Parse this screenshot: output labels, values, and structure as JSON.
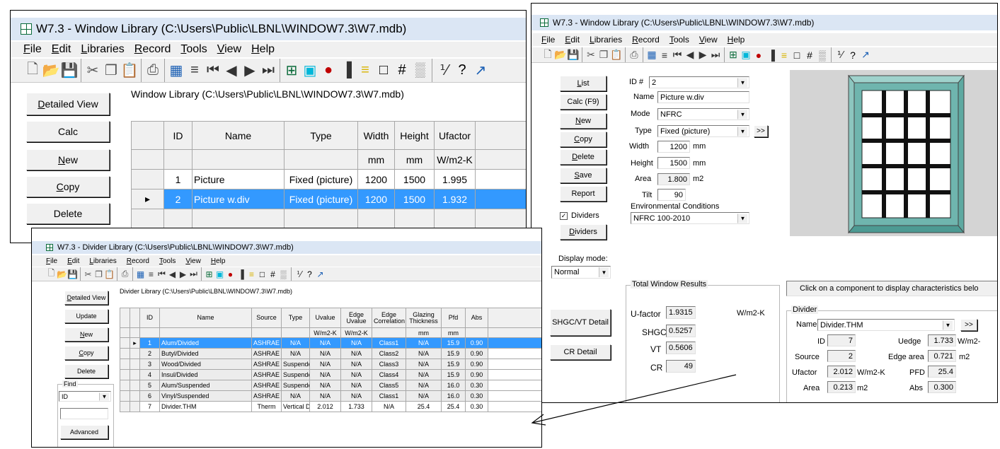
{
  "library_window": {
    "title": "W7.3 - Window Library (C:\\Users\\Public\\LBNL\\WINDOW7.3\\W7.mdb)",
    "menu": [
      "File",
      "Edit",
      "Libraries",
      "Record",
      "Tools",
      "View",
      "Help"
    ],
    "path_label": "Window Library (C:\\Users\\Public\\LBNL\\WINDOW7.3\\W7.mdb)",
    "buttons": {
      "detailed_view": "Detailed View",
      "calc": "Calc",
      "new": "New",
      "copy": "Copy",
      "delete": "Delete"
    },
    "table": {
      "headers": [
        "ID",
        "Name",
        "Type",
        "Width",
        "Height",
        "Ufactor"
      ],
      "units": [
        "",
        "",
        "",
        "mm",
        "mm",
        "W/m2-K"
      ],
      "rows": [
        [
          "1",
          "Picture",
          "Fixed (picture)",
          "1200",
          "1500",
          "1.995"
        ],
        [
          "2",
          "Picture w.div",
          "Fixed (picture)",
          "1200",
          "1500",
          "1.932"
        ]
      ]
    }
  },
  "detail_window": {
    "title": "W7.3 - Window Library (C:\\Users\\Public\\LBNL\\WINDOW7.3\\W7.mdb)",
    "menu": [
      "File",
      "Edit",
      "Libraries",
      "Record",
      "Tools",
      "View",
      "Help"
    ],
    "buttons": {
      "list": "List",
      "calc_f9": "Calc (F9)",
      "new": "New",
      "copy": "Copy",
      "delete": "Delete",
      "save": "Save",
      "report": "Report",
      "dividers": "Dividers",
      "shgc_vt": "SHGC/VT Detail",
      "cr_detail": "CR Detail",
      "more": ">>"
    },
    "form": {
      "id_label": "ID #",
      "id_value": "2",
      "name_label": "Name",
      "name_value": "Picture w.div",
      "mode_label": "Mode",
      "mode_value": "NFRC",
      "type_label": "Type",
      "type_value": "Fixed (picture)",
      "width_label": "Width",
      "width_value": "1200",
      "width_unit": "mm",
      "height_label": "Height",
      "height_value": "1500",
      "height_unit": "mm",
      "area_label": "Area",
      "area_value": "1.800",
      "area_unit": "m2",
      "tilt_label": "Tilt",
      "tilt_value": "90",
      "env_label": "Environmental Conditions",
      "env_value": "NFRC 100-2010"
    },
    "dividers_checkbox": {
      "label": "Dividers",
      "checked": true
    },
    "display_mode": {
      "label": "Display mode:",
      "value": "Normal"
    },
    "results": {
      "title": "Total Window Results",
      "ufactor_label": "U-factor",
      "ufactor_value": "1.9315",
      "ufactor_unit": "W/m2-K",
      "shgc_label": "SHGC",
      "shgc_value": "0.5257",
      "vt_label": "VT",
      "vt_value": "0.5606",
      "cr_label": "CR",
      "cr_value": "49"
    },
    "hint": "Click on a component to display characteristics belo",
    "divider_panel": {
      "title": "Divider",
      "name_label": "Name",
      "name_value": "Divider.THM",
      "id_label": "ID",
      "id_value": "7",
      "uedge_label": "Uedge",
      "uedge_value": "1.733",
      "uedge_unit": "W/m2-",
      "source_label": "Source",
      "source_value": "2",
      "edge_area_label": "Edge area",
      "edge_area_value": "0.721",
      "edge_area_unit": "m2",
      "ufactor_label": "Ufactor",
      "ufactor_value": "2.012",
      "ufactor_unit": "W/m2-K",
      "pfd_label": "PFD",
      "pfd_value": "25.4",
      "area_label": "Area",
      "area_value": "0.213",
      "area_unit": "m2",
      "abs_label": "Abs",
      "abs_value": "0.300"
    },
    "colors": {
      "frame": "#6fb5ae",
      "glass": "#ffffff",
      "grid": "#111111",
      "preview_bg": "#d4d4d4"
    }
  },
  "divider_window": {
    "title": "W7.3 - Divider Library (C:\\Users\\Public\\LBNL\\WINDOW7.3\\W7.mdb)",
    "menu": [
      "File",
      "Edit",
      "Libraries",
      "Record",
      "Tools",
      "View",
      "Help"
    ],
    "path_label": "Divider Library (C:\\Users\\Public\\LBNL\\WINDOW7.3\\W7.mdb)",
    "buttons": {
      "detailed_view": "Detailed View",
      "update": "Update",
      "new": "New",
      "copy": "Copy",
      "delete": "Delete",
      "advanced": "Advanced"
    },
    "find": {
      "label": "Find",
      "value": "ID"
    },
    "table": {
      "headers": [
        "ID",
        "Name",
        "Source",
        "Type",
        "Uvalue",
        "Edge Uvalue",
        "Edge Correlation",
        "Glazing Thickness",
        "Pfd",
        "Abs"
      ],
      "units": [
        "",
        "",
        "",
        "",
        "W/m2-K",
        "W/m2-K",
        "",
        "mm",
        "mm",
        ""
      ],
      "rows": [
        [
          "1",
          "Alum/Divided",
          "ASHRAE",
          "N/A",
          "N/A",
          "N/A",
          "Class1",
          "N/A",
          "15.9",
          "0.90"
        ],
        [
          "2",
          "Butyl/Divided",
          "ASHRAE",
          "N/A",
          "N/A",
          "N/A",
          "Class2",
          "N/A",
          "15.9",
          "0.90"
        ],
        [
          "3",
          "Wood/Divided",
          "ASHRAE",
          "Suspende",
          "N/A",
          "N/A",
          "Class3",
          "N/A",
          "15.9",
          "0.90"
        ],
        [
          "4",
          "Insul/Divided",
          "ASHRAE",
          "Suspende",
          "N/A",
          "N/A",
          "Class4",
          "N/A",
          "15.9",
          "0.90"
        ],
        [
          "5",
          "Alum/Suspended",
          "ASHRAE",
          "Suspende",
          "N/A",
          "N/A",
          "Class5",
          "N/A",
          "16.0",
          "0.30"
        ],
        [
          "6",
          "Vinyl/Suspended",
          "ASHRAE",
          "N/A",
          "N/A",
          "N/A",
          "Class1",
          "N/A",
          "16.0",
          "0.30"
        ],
        [
          "7",
          "Divider.THM",
          "Therm",
          "Vertical D",
          "2.012",
          "1.733",
          "N/A",
          "25.4",
          "25.4",
          "0.30"
        ]
      ]
    }
  }
}
